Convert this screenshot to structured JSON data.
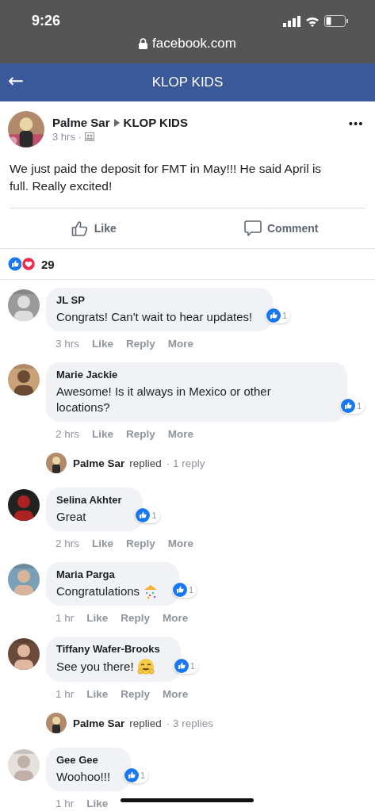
{
  "status_bar": {
    "time": "9:26",
    "url": "facebook.com"
  },
  "nav": {
    "back": "←",
    "title": "KLOP KIDS"
  },
  "post": {
    "author": "Palme Sar",
    "group": "KLOP KIDS",
    "time": "3 hrs ·",
    "menu": "•••",
    "text": "We just paid the deposit for FMT in May!!! He said April is full. Really excited!",
    "actions": [
      {
        "kind": "like",
        "label": "Like"
      },
      {
        "kind": "comment",
        "label": "Comment"
      }
    ],
    "reaction_count": "29"
  },
  "comments": [
    {
      "kind": "comment",
      "author": "JL SP",
      "text": "Congrats! Can't wait to hear updates!",
      "likes": "1",
      "time": "3 hrs",
      "actions": [
        "Like",
        "Reply",
        "More"
      ]
    },
    {
      "kind": "comment",
      "author": "Marie Jackie",
      "text": "Awesome! Is it always in Mexico or other locations?",
      "likes": "1",
      "time": "2 hrs",
      "actions": [
        "Like",
        "Reply",
        "More"
      ]
    },
    {
      "kind": "replies",
      "author": "Palme Sar",
      "verb": "replied",
      "count": "· 1 reply"
    },
    {
      "kind": "comment",
      "author": "Selina Akhter",
      "text": "Great",
      "likes": "1",
      "time": "2 hrs",
      "actions": [
        "Like",
        "Reply",
        "More"
      ]
    },
    {
      "kind": "comment",
      "author": "Maria Parga",
      "text": "Congratulations",
      "emoji": {
        "kind": "party"
      },
      "likes": "1",
      "time": "1 hr",
      "actions": [
        "Like",
        "Reply",
        "More"
      ]
    },
    {
      "kind": "comment",
      "author": "Tiffany Wafer-Brooks",
      "text": "See you there!",
      "emoji": {
        "kind": "smile"
      },
      "likes": "1",
      "time": "1 hr",
      "actions": [
        "Like",
        "Reply",
        "More"
      ]
    },
    {
      "kind": "replies",
      "author": "Palme Sar",
      "verb": "replied",
      "count": "· 3 replies"
    },
    {
      "kind": "comment",
      "author": "Gee Gee",
      "text": "Woohoo!!!",
      "likes": "1",
      "time": "1 hr",
      "actions": [
        "Like"
      ]
    }
  ]
}
